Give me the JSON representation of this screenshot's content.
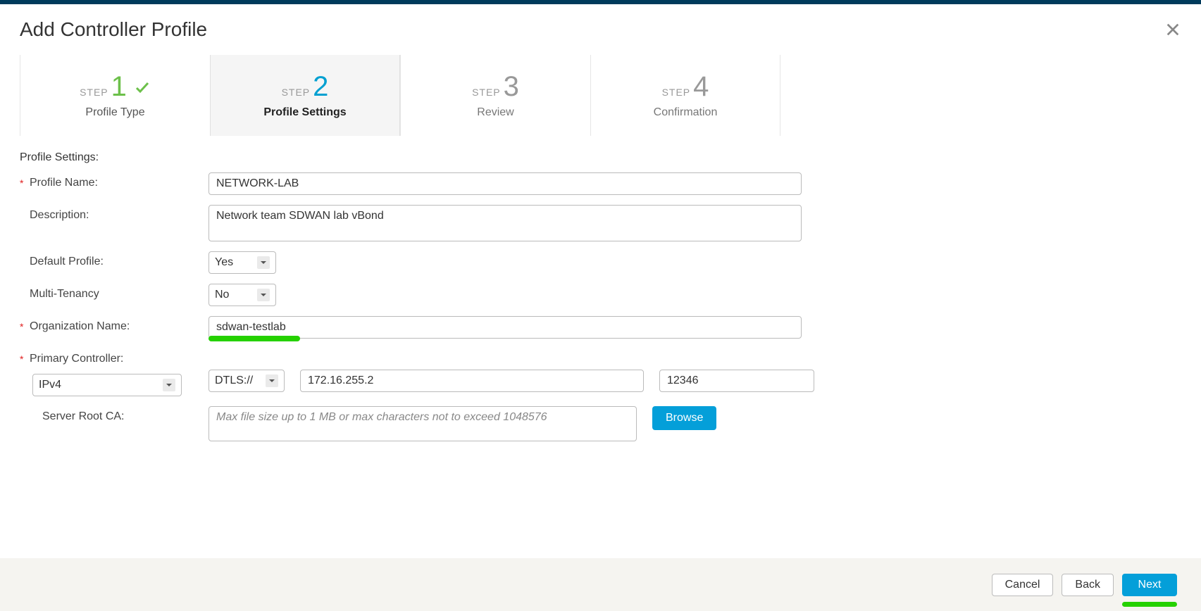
{
  "dialog": {
    "title": "Add Controller Profile"
  },
  "steps": {
    "word": "STEP",
    "items": [
      {
        "num": "1",
        "label": "Profile Type",
        "state": "completed"
      },
      {
        "num": "2",
        "label": "Profile Settings",
        "state": "active"
      },
      {
        "num": "3",
        "label": "Review",
        "state": "upcoming"
      },
      {
        "num": "4",
        "label": "Confirmation",
        "state": "upcoming"
      }
    ]
  },
  "section": {
    "heading": "Profile Settings:"
  },
  "fields": {
    "profile_name": {
      "label": "Profile Name:",
      "value": "NETWORK-LAB",
      "required": true
    },
    "description": {
      "label": "Description:",
      "value": "Network team SDWAN lab vBond",
      "required": false
    },
    "default_profile": {
      "label": "Default Profile:",
      "value": "Yes",
      "required": false
    },
    "multi_tenancy": {
      "label": "Multi-Tenancy",
      "value": "No",
      "required": false
    },
    "org_name": {
      "label": "Organization Name:",
      "value": "sdwan-testlab",
      "required": true
    },
    "primary_controller": {
      "label": "Primary Controller:",
      "required": true,
      "ip_version": "IPv4",
      "protocol": "DTLS://",
      "address": "172.16.255.2",
      "port": "12346"
    },
    "server_root_ca": {
      "label": "Server Root CA:",
      "placeholder": "Max file size up to 1 MB or max characters not to exceed 1048576",
      "browse": "Browse"
    }
  },
  "footer": {
    "cancel": "Cancel",
    "back": "Back",
    "next": "Next"
  }
}
